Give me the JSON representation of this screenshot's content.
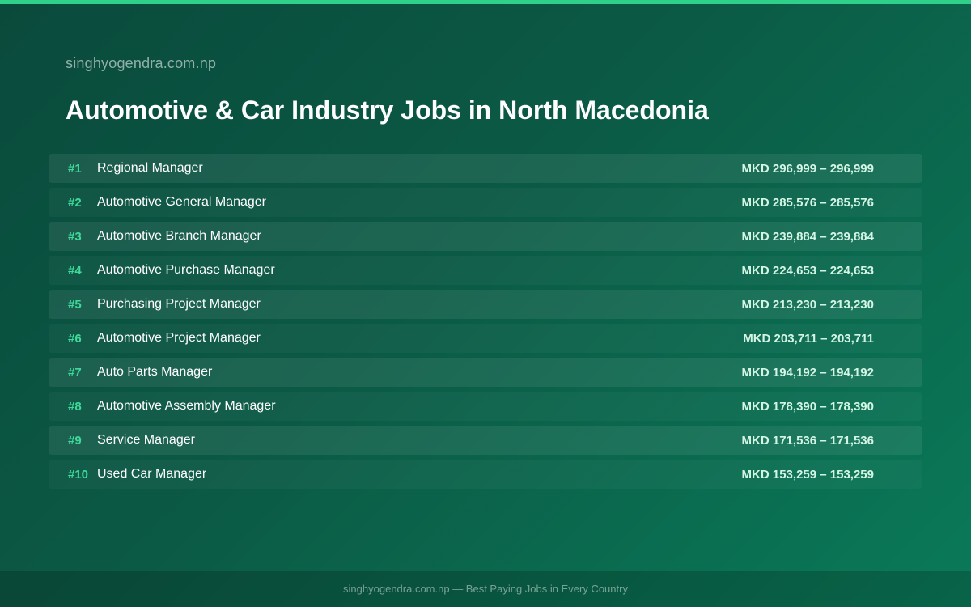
{
  "header": {
    "site": "singhyogendra.com.np",
    "title": "Automotive & Car Industry Jobs in North Macedonia"
  },
  "jobs": [
    {
      "rank": "#1",
      "title": "Regional Manager",
      "salary": "MKD 296,999 – 296,999"
    },
    {
      "rank": "#2",
      "title": "Automotive General Manager",
      "salary": "MKD 285,576 – 285,576"
    },
    {
      "rank": "#3",
      "title": "Automotive Branch Manager",
      "salary": "MKD 239,884 – 239,884"
    },
    {
      "rank": "#4",
      "title": "Automotive Purchase Manager",
      "salary": "MKD 224,653 – 224,653"
    },
    {
      "rank": "#5",
      "title": "Purchasing Project Manager",
      "salary": "MKD 213,230 – 213,230"
    },
    {
      "rank": "#6",
      "title": "Automotive Project Manager",
      "salary": "MKD 203,711 – 203,711"
    },
    {
      "rank": "#7",
      "title": "Auto Parts Manager",
      "salary": "MKD 194,192 – 194,192"
    },
    {
      "rank": "#8",
      "title": "Automotive Assembly Manager",
      "salary": "MKD 178,390 – 178,390"
    },
    {
      "rank": "#9",
      "title": "Service Manager",
      "salary": "MKD 171,536 – 171,536"
    },
    {
      "rank": "#10",
      "title": "Used Car Manager",
      "salary": "MKD 153,259 – 153,259"
    }
  ],
  "footer": {
    "text": "singhyogendra.com.np — Best Paying Jobs in Every Country"
  },
  "colors": {
    "accent": "#3fd99a",
    "top_strip": "#2fd08a",
    "background_start": "#0a4a3c",
    "background_end": "#0a7a58"
  }
}
